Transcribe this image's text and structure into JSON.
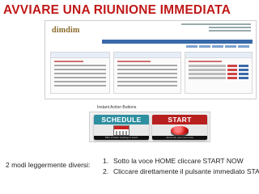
{
  "title": "AVVIARE UNA RIUNIONE IMMEDIATA",
  "screenshot": {
    "logo": "dimdim",
    "instant_caption": "Instant Action Buttons",
    "buttons": [
      {
        "label": "SCHEDULE",
        "caption": "Plan a future meeting or event"
      },
      {
        "label": "START",
        "caption": "Jump into your room now"
      }
    ]
  },
  "side_label": "2 modi leggermente diversi:",
  "steps": [
    {
      "num": "1.",
      "text": "Sotto la voce HOME cliccare START NOW"
    },
    {
      "num": "2.",
      "text": "Cliccare direttamente il pulsante immediato START"
    }
  ],
  "colors": {
    "title": "#c01818",
    "schedule": "#2e8fa0",
    "start": "#b82020"
  }
}
